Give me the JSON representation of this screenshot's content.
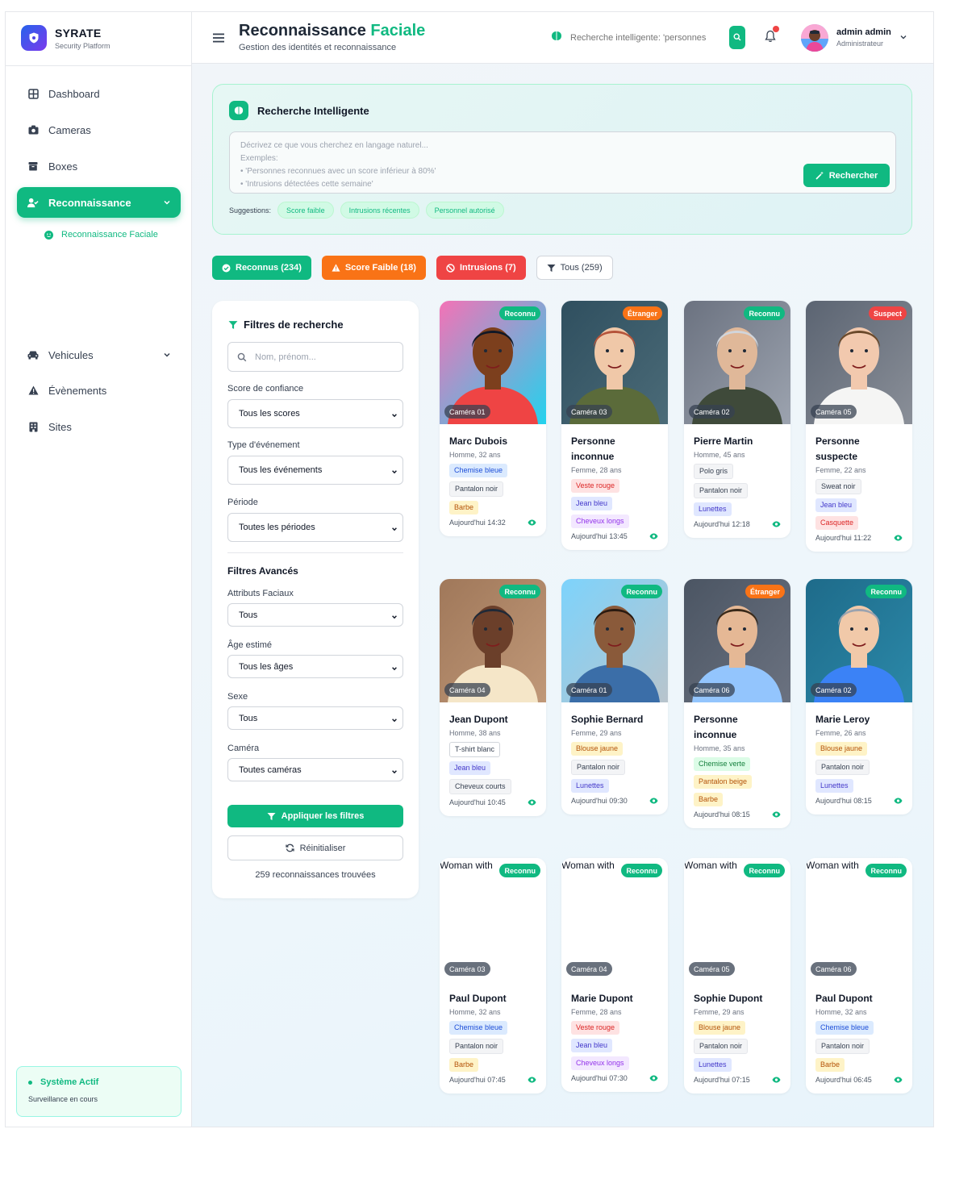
{
  "brand": {
    "name": "SYRATE",
    "subtitle": "Security Platform"
  },
  "sidebar": {
    "items": [
      {
        "label": "Dashboard",
        "icon": "grid-icon"
      },
      {
        "label": "Cameras",
        "icon": "camera-icon"
      },
      {
        "label": "Boxes",
        "icon": "box-icon"
      },
      {
        "label": "Reconnaissance",
        "icon": "user-check-icon",
        "active": true
      },
      {
        "label": "Vehicules",
        "icon": "car-icon"
      },
      {
        "label": "Évènements",
        "icon": "warning-icon"
      },
      {
        "label": "Sites",
        "icon": "building-icon"
      }
    ],
    "subitem": "Reconnaissance Faciale",
    "status": {
      "title": "Système Actif",
      "subtitle": "Surveillance en cours"
    }
  },
  "header": {
    "title_main": "Reconnaissance",
    "title_accent": "Faciale",
    "subtitle": "Gestion des identités et reconnaissance",
    "search_placeholder": "Recherche intelligente: 'personnes",
    "user_name": "admin admin",
    "user_role": "Administrateur"
  },
  "ai_search": {
    "title": "Recherche Intelligente",
    "lines": [
      "Décrivez ce que vous cherchez en langage naturel...",
      "Exemples:",
      "• 'Personnes reconnues avec un score inférieur à 80%'",
      "• 'Intrusions détectées cette semaine'"
    ],
    "button": "Rechercher",
    "suggestions_label": "Suggestions:",
    "suggestions": [
      "Score faible",
      "Intrusions récentes",
      "Personnel autorisé"
    ]
  },
  "quick_filters": [
    {
      "label": "Reconnus (234)",
      "color": "#10b981"
    },
    {
      "label": "Score Faible (18)",
      "color": "#f97316"
    },
    {
      "label": "Intrusions (7)",
      "color": "#ef4444"
    },
    {
      "label": "Tous (259)",
      "color": "#ffffff"
    }
  ],
  "filter_panel": {
    "title": "Filtres de recherche",
    "search_placeholder": "Nom, prénom...",
    "score_label": "Score de confiance",
    "score_value": "Tous les scores",
    "event_label": "Type d'événement",
    "event_value": "Tous les événements",
    "period_label": "Période",
    "period_value": "Toutes les périodes",
    "advanced_title": "Filtres Avancés",
    "facial_label": "Attributs Faciaux",
    "facial_value": "Tous",
    "age_label": "Âge estimé",
    "age_value": "Tous les âges",
    "sex_label": "Sexe",
    "sex_value": "Tous",
    "camera_label": "Caméra",
    "camera_value": "Toutes caméras",
    "apply": "Appliquer les filtres",
    "reset": "Réinitialiser",
    "count": "259 reconnaissances trouvées"
  },
  "cards": [
    {
      "name": "Marc Dubois",
      "meta": "Homme, 32 ans",
      "status": "Reconnu",
      "camera": "Caméra 01",
      "time": "Aujourd'hui 14:32",
      "tags": [
        [
          "Chemise bleue",
          "blue"
        ],
        [
          "Pantalon noir",
          "gray"
        ],
        [
          "Barbe",
          "yellow"
        ]
      ]
    },
    {
      "name": "Personne inconnue",
      "meta": "Femme, 28 ans",
      "status": "Étranger",
      "camera": "Caméra 03",
      "time": "Aujourd'hui 13:45",
      "tags": [
        [
          "Veste rouge",
          "red"
        ],
        [
          "Jean bleu",
          "indigo"
        ],
        [
          "Cheveux longs",
          "purple"
        ]
      ]
    },
    {
      "name": "Pierre Martin",
      "meta": "Homme, 45 ans",
      "status": "Reconnu",
      "camera": "Caméra 02",
      "time": "Aujourd'hui 12:18",
      "tags": [
        [
          "Polo gris",
          "gray"
        ],
        [
          "Pantalon noir",
          "gray"
        ],
        [
          "Lunettes",
          "indigo"
        ]
      ]
    },
    {
      "name": "Personne suspecte",
      "meta": "Femme, 22 ans",
      "status": "Suspect",
      "camera": "Caméra 05",
      "time": "Aujourd'hui 11:22",
      "tags": [
        [
          "Sweat noir",
          "gray"
        ],
        [
          "Jean bleu",
          "indigo"
        ],
        [
          "Casquette",
          "red"
        ]
      ]
    },
    {
      "name": "Jean Dupont",
      "meta": "Homme, 38 ans",
      "status": "Reconnu",
      "camera": "Caméra 04",
      "time": "Aujourd'hui 10:45",
      "tags": [
        [
          "T-shirt blanc",
          "white"
        ],
        [
          "Jean bleu",
          "indigo"
        ],
        [
          "Cheveux courts",
          "gray"
        ]
      ]
    },
    {
      "name": "Sophie Bernard",
      "meta": "Femme, 29 ans",
      "status": "Reconnu",
      "camera": "Caméra 01",
      "time": "Aujourd'hui 09:30",
      "tags": [
        [
          "Blouse jaune",
          "yellow"
        ],
        [
          "Pantalon noir",
          "gray"
        ],
        [
          "Lunettes",
          "indigo"
        ]
      ]
    },
    {
      "name": "Personne inconnue",
      "meta": "Homme, 35 ans",
      "status": "Étranger",
      "camera": "Caméra 06",
      "time": "Aujourd'hui 08:15",
      "tags": [
        [
          "Chemise verte",
          "green"
        ],
        [
          "Pantalon beige",
          "yellow"
        ],
        [
          "Barbe",
          "yellow"
        ]
      ]
    },
    {
      "name": "Marie Leroy",
      "meta": "Femme, 26 ans",
      "status": "Reconnu",
      "camera": "Caméra 02",
      "time": "Aujourd'hui 08:15",
      "tags": [
        [
          "Blouse jaune",
          "yellow"
        ],
        [
          "Pantalon noir",
          "gray"
        ],
        [
          "Lunettes",
          "indigo"
        ]
      ]
    },
    {
      "name": "Paul Dupont",
      "meta": "Homme, 32 ans",
      "status": "Reconnu",
      "camera": "Caméra 03",
      "time": "Aujourd'hui 07:45",
      "alt": "Woman with",
      "tags": [
        [
          "Chemise bleue",
          "blue"
        ],
        [
          "Pantalon noir",
          "gray"
        ],
        [
          "Barbe",
          "yellow"
        ]
      ]
    },
    {
      "name": "Marie Dupont",
      "meta": "Femme, 28 ans",
      "status": "Reconnu",
      "camera": "Caméra 04",
      "time": "Aujourd'hui 07:30",
      "alt": "Woman with",
      "tags": [
        [
          "Veste rouge",
          "red"
        ],
        [
          "Jean bleu",
          "indigo"
        ],
        [
          "Cheveux longs",
          "purple"
        ]
      ]
    },
    {
      "name": "Sophie Dupont",
      "meta": "Femme, 29 ans",
      "status": "Reconnu",
      "camera": "Caméra 05",
      "time": "Aujourd'hui 07:15",
      "alt": "Woman with",
      "tags": [
        [
          "Blouse jaune",
          "yellow"
        ],
        [
          "Pantalon noir",
          "gray"
        ],
        [
          "Lunettes",
          "indigo"
        ]
      ]
    },
    {
      "name": "Paul Dupont",
      "meta": "Homme, 32 ans",
      "status": "Reconnu",
      "camera": "Caméra 06",
      "time": "Aujourd'hui 06:45",
      "alt": "Woman with",
      "tags": [
        [
          "Chemise bleue",
          "blue"
        ],
        [
          "Pantalon noir",
          "gray"
        ],
        [
          "Barbe",
          "yellow"
        ]
      ]
    }
  ],
  "colors": {
    "accent": "#10b981",
    "warning": "#f97316",
    "danger": "#ef4444"
  }
}
